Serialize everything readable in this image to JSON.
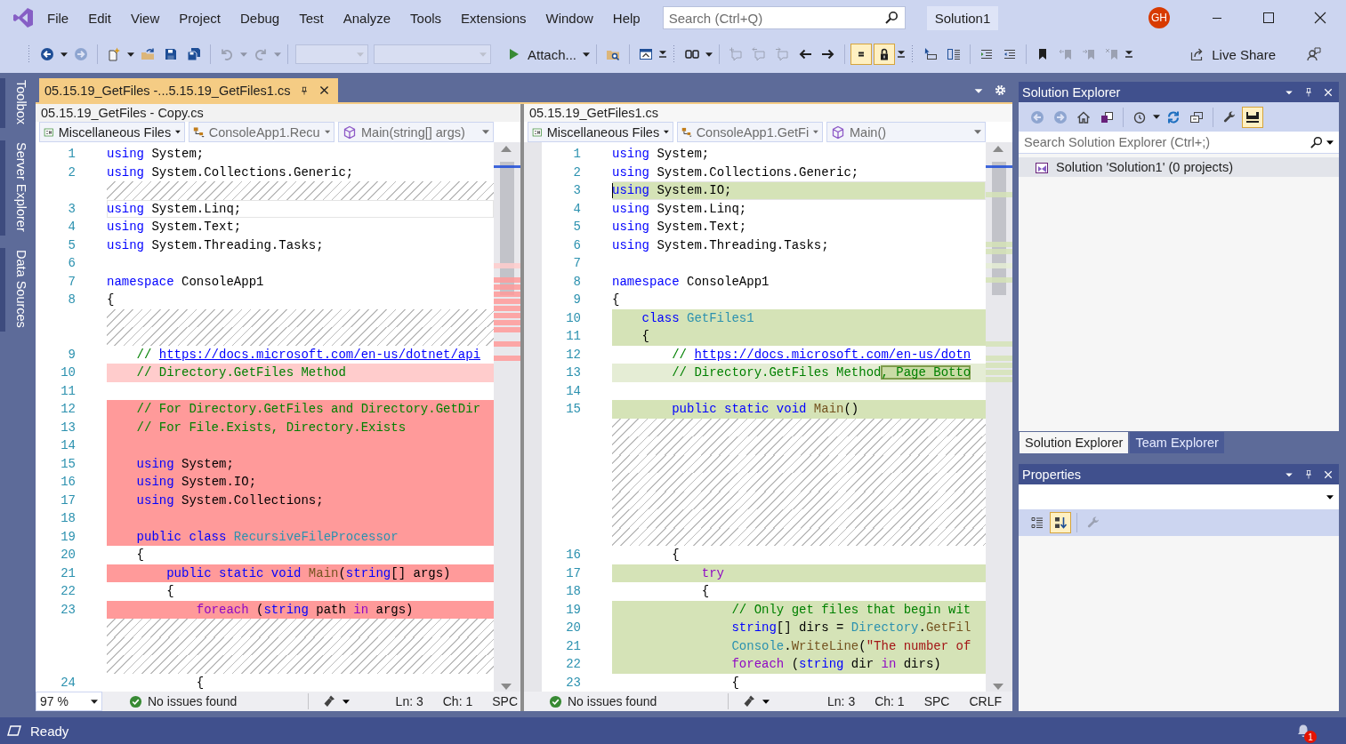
{
  "menu": [
    {
      "label": "File"
    },
    {
      "label": "Edit"
    },
    {
      "label": "View"
    },
    {
      "label": "Project"
    },
    {
      "label": "Debug"
    },
    {
      "label": "Test"
    },
    {
      "label": "Analyze"
    },
    {
      "label": "Tools"
    },
    {
      "label": "Extensions"
    },
    {
      "label": "Window"
    },
    {
      "label": "Help"
    }
  ],
  "search": {
    "placeholder": "Search (Ctrl+Q)"
  },
  "solution_name": "Solution1",
  "account": {
    "initials": "GH"
  },
  "toolbar": [
    {
      "kind": "grip"
    },
    {
      "kind": "back",
      "disabled": false
    },
    {
      "kind": "dropdown",
      "disabled": false
    },
    {
      "kind": "forward",
      "disabled": true
    },
    {
      "kind": "separator"
    },
    {
      "kind": "new-item",
      "disabled": false
    },
    {
      "kind": "dropdown",
      "disabled": false
    },
    {
      "kind": "open",
      "disabled": false
    },
    {
      "kind": "save",
      "disabled": false
    },
    {
      "kind": "save-all",
      "disabled": false
    },
    {
      "kind": "separator"
    },
    {
      "kind": "undo",
      "disabled": true
    },
    {
      "kind": "dropdown",
      "disabled": true
    },
    {
      "kind": "redo",
      "disabled": true
    },
    {
      "kind": "dropdown",
      "disabled": true
    },
    {
      "kind": "separator"
    },
    {
      "kind": "combo",
      "disabled": true
    },
    {
      "kind": "combo",
      "disabled": true
    },
    {
      "kind": "run",
      "label": "Attach...",
      "disabled": false
    },
    {
      "kind": "dropdown",
      "disabled": false
    },
    {
      "kind": "separator"
    },
    {
      "kind": "find-folder",
      "disabled": false
    },
    {
      "kind": "separator"
    },
    {
      "kind": "window",
      "disabled": false
    },
    {
      "kind": "overflow",
      "disabled": false
    },
    {
      "kind": "grip"
    },
    {
      "kind": "layout",
      "disabled": false
    },
    {
      "kind": "dropdown",
      "disabled": false
    },
    {
      "kind": "separator"
    },
    {
      "kind": "comment-add",
      "disabled": true
    },
    {
      "kind": "comment-prev",
      "disabled": true
    },
    {
      "kind": "comment-next",
      "disabled": true
    },
    {
      "kind": "arrow-left",
      "disabled": false
    },
    {
      "kind": "arrow-right",
      "disabled": false
    },
    {
      "kind": "separator"
    },
    {
      "kind": "equal",
      "disabled": false,
      "checked": true
    },
    {
      "kind": "lock",
      "disabled": false,
      "checked": true
    },
    {
      "kind": "overflow",
      "disabled": false
    },
    {
      "kind": "grip"
    },
    {
      "kind": "cursor-field",
      "disabled": false
    },
    {
      "kind": "compare",
      "disabled": false
    },
    {
      "kind": "separator"
    },
    {
      "kind": "indent",
      "disabled": false
    },
    {
      "kind": "outdent",
      "disabled": false
    },
    {
      "kind": "separator"
    },
    {
      "kind": "bookmark",
      "disabled": false
    },
    {
      "kind": "bookmark-prev",
      "disabled": true
    },
    {
      "kind": "bookmark-next",
      "disabled": true
    },
    {
      "kind": "bookmark-clear",
      "disabled": true
    },
    {
      "kind": "overflow",
      "disabled": false
    }
  ],
  "live_share": {
    "label": "Live Share"
  },
  "side_tabs": [
    {
      "label": "Toolbox"
    },
    {
      "label": "Server Explorer"
    },
    {
      "label": "Data Sources"
    }
  ],
  "document_tab": {
    "title": "05.15.19_GetFiles -...5.15.19_GetFiles1.cs",
    "selected": true
  },
  "panes": [
    {
      "kind": "before",
      "focused": false,
      "file": "05.15.19_GetFiles - Copy.cs",
      "nav": [
        {
          "kind": "project",
          "label": "Miscellaneous Files"
        },
        {
          "kind": "class",
          "label": "ConsoleApp1.Recu"
        },
        {
          "kind": "member",
          "label": "Main(string[] args)"
        }
      ],
      "lines": [
        {
          "kind": "code",
          "number": "1",
          "changed": false,
          "current": false,
          "spans": [
            {
              "text": "using",
              "kind": "keyword"
            },
            {
              "text": " System;",
              "kind": "plain"
            }
          ]
        },
        {
          "kind": "code",
          "number": "2",
          "changed": false,
          "current": false,
          "spans": [
            {
              "text": "using",
              "kind": "keyword"
            },
            {
              "text": " System.Collections.Generic;",
              "kind": "plain"
            }
          ]
        },
        {
          "kind": "gap"
        },
        {
          "kind": "code",
          "number": "3",
          "changed": false,
          "current": true,
          "spans": [
            {
              "text": "using",
              "kind": "keyword"
            },
            {
              "text": " System.Linq;",
              "kind": "plain"
            }
          ]
        },
        {
          "kind": "code",
          "number": "4",
          "changed": false,
          "current": false,
          "spans": [
            {
              "text": "using",
              "kind": "keyword"
            },
            {
              "text": " System.Text;",
              "kind": "plain"
            }
          ]
        },
        {
          "kind": "code",
          "number": "5",
          "changed": false,
          "current": false,
          "spans": [
            {
              "text": "using",
              "kind": "keyword"
            },
            {
              "text": " System.Threading.Tasks;",
              "kind": "plain"
            }
          ]
        },
        {
          "kind": "code",
          "number": "6",
          "changed": false,
          "current": false
        },
        {
          "kind": "code",
          "number": "7",
          "changed": false,
          "current": false,
          "spans": [
            {
              "text": "namespace",
              "kind": "keyword"
            },
            {
              "text": " ConsoleApp1",
              "kind": "plain"
            }
          ]
        },
        {
          "kind": "code",
          "number": "8",
          "changed": false,
          "current": false,
          "spans": [
            {
              "text": "{",
              "kind": "plain"
            }
          ]
        },
        {
          "kind": "gap"
        },
        {
          "kind": "gap"
        },
        {
          "kind": "code",
          "number": "9",
          "changed": false,
          "current": false,
          "spans": [
            {
              "text": "    // ",
              "kind": "comment"
            },
            {
              "text": "https://docs.microsoft.com/en-us/dotnet/api",
              "kind": "link"
            }
          ]
        },
        {
          "kind": "edited",
          "number": "10",
          "current": false,
          "spans": [
            {
              "text": "    // Directory.GetFiles Method",
              "kind": "comment"
            }
          ]
        },
        {
          "kind": "code",
          "number": "11",
          "changed": false,
          "current": false
        },
        {
          "kind": "code",
          "number": "12",
          "changed": true,
          "current": false,
          "spans": [
            {
              "text": "    // For Directory.GetFiles and Directory.GetDir",
              "kind": "comment"
            }
          ]
        },
        {
          "kind": "code",
          "number": "13",
          "changed": true,
          "current": false,
          "spans": [
            {
              "text": "    // For File.Exists, Directory.Exists",
              "kind": "comment"
            }
          ]
        },
        {
          "kind": "code",
          "number": "14",
          "changed": true,
          "current": false
        },
        {
          "kind": "code",
          "number": "15",
          "changed": true,
          "current": false,
          "spans": [
            {
              "text": "    using",
              "kind": "keyword"
            },
            {
              "text": " System;",
              "kind": "plain"
            }
          ]
        },
        {
          "kind": "code",
          "number": "16",
          "changed": true,
          "current": false,
          "spans": [
            {
              "text": "    using",
              "kind": "keyword"
            },
            {
              "text": " System.IO;",
              "kind": "plain"
            }
          ]
        },
        {
          "kind": "code",
          "number": "17",
          "changed": true,
          "current": false,
          "spans": [
            {
              "text": "    using",
              "kind": "keyword"
            },
            {
              "text": " System.Collections;",
              "kind": "plain"
            }
          ]
        },
        {
          "kind": "code",
          "number": "18",
          "changed": true,
          "current": false
        },
        {
          "kind": "code",
          "number": "19",
          "changed": true,
          "current": false,
          "spans": [
            {
              "text": "    public class ",
              "kind": "keyword"
            },
            {
              "text": "RecursiveFileProcessor",
              "kind": "type"
            }
          ]
        },
        {
          "kind": "code",
          "number": "20",
          "changed": false,
          "current": false,
          "spans": [
            {
              "text": "    {",
              "kind": "plain"
            }
          ]
        },
        {
          "kind": "code",
          "number": "21",
          "changed": true,
          "current": false,
          "spans": [
            {
              "text": "        public static void ",
              "kind": "keyword"
            },
            {
              "text": "Main",
              "kind": "method"
            },
            {
              "text": "(",
              "kind": "plain"
            },
            {
              "text": "string",
              "kind": "keyword"
            },
            {
              "text": "[] args)",
              "kind": "plain"
            }
          ]
        },
        {
          "kind": "code",
          "number": "22",
          "changed": false,
          "current": false,
          "spans": [
            {
              "text": "        {",
              "kind": "plain"
            }
          ]
        },
        {
          "kind": "code",
          "number": "23",
          "changed": true,
          "current": false,
          "spans": [
            {
              "text": "            foreach",
              "kind": "control"
            },
            {
              "text": " (",
              "kind": "plain"
            },
            {
              "text": "string",
              "kind": "keyword"
            },
            {
              "text": " path ",
              "kind": "plain"
            },
            {
              "text": "in",
              "kind": "control"
            },
            {
              "text": " args)",
              "kind": "plain"
            }
          ]
        },
        {
          "kind": "gap"
        },
        {
          "kind": "gap"
        },
        {
          "kind": "gap"
        },
        {
          "kind": "code",
          "number": "24",
          "changed": false,
          "current": false,
          "spans": [
            {
              "text": "            {",
              "kind": "plain"
            }
          ]
        }
      ],
      "status": {
        "zoom": "97 %",
        "issues": "No issues found",
        "ln": "Ln: 3",
        "ch": "Ch: 1",
        "spc": "SPC"
      }
    },
    {
      "kind": "after",
      "focused": true,
      "file": "05.15.19_GetFiles1.cs",
      "nav": [
        {
          "kind": "project",
          "label": "Miscellaneous Files"
        },
        {
          "kind": "class",
          "label": "ConsoleApp1.GetFi"
        },
        {
          "kind": "member",
          "label": "Main()"
        }
      ],
      "lines": [
        {
          "kind": "code",
          "number": "1",
          "changed": false,
          "current": false,
          "spans": [
            {
              "text": "using",
              "kind": "keyword"
            },
            {
              "text": " System;",
              "kind": "plain"
            }
          ]
        },
        {
          "kind": "code",
          "number": "2",
          "changed": false,
          "current": false,
          "spans": [
            {
              "text": "using",
              "kind": "keyword"
            },
            {
              "text": " System.Collections.Generic;",
              "kind": "plain"
            }
          ]
        },
        {
          "kind": "code",
          "number": "3",
          "changed": true,
          "current": true,
          "spans": [
            {
              "text": "using",
              "kind": "keyword"
            },
            {
              "text": " System.IO;",
              "kind": "plain"
            }
          ]
        },
        {
          "kind": "code",
          "number": "4",
          "changed": false,
          "current": false,
          "spans": [
            {
              "text": "using",
              "kind": "keyword"
            },
            {
              "text": " System.Linq;",
              "kind": "plain"
            }
          ]
        },
        {
          "kind": "code",
          "number": "5",
          "changed": false,
          "current": false,
          "spans": [
            {
              "text": "using",
              "kind": "keyword"
            },
            {
              "text": " System.Text;",
              "kind": "plain"
            }
          ]
        },
        {
          "kind": "code",
          "number": "6",
          "changed": false,
          "current": false,
          "spans": [
            {
              "text": "using",
              "kind": "keyword"
            },
            {
              "text": " System.Threading.Tasks;",
              "kind": "plain"
            }
          ]
        },
        {
          "kind": "code",
          "number": "7",
          "changed": false,
          "current": false
        },
        {
          "kind": "code",
          "number": "8",
          "changed": false,
          "current": false,
          "spans": [
            {
              "text": "namespace",
              "kind": "keyword"
            },
            {
              "text": " ConsoleApp1",
              "kind": "plain"
            }
          ]
        },
        {
          "kind": "code",
          "number": "9",
          "changed": false,
          "current": false,
          "spans": [
            {
              "text": "{",
              "kind": "plain"
            }
          ]
        },
        {
          "kind": "code",
          "number": "10",
          "changed": true,
          "current": false,
          "spans": [
            {
              "text": "    class ",
              "kind": "keyword"
            },
            {
              "text": "GetFiles1",
              "kind": "type"
            }
          ]
        },
        {
          "kind": "code",
          "number": "11",
          "changed": true,
          "current": false,
          "spans": [
            {
              "text": "    {",
              "kind": "plain"
            }
          ]
        },
        {
          "kind": "code",
          "number": "12",
          "changed": false,
          "current": false,
          "spans": [
            {
              "text": "        // ",
              "kind": "comment"
            },
            {
              "text": "https://docs.microsoft.com/en-us/dotn",
              "kind": "link"
            }
          ]
        },
        {
          "kind": "edited",
          "number": "13",
          "current": false,
          "spans": [
            {
              "text": "        // Directory.GetFiles Method",
              "kind": "comment"
            },
            {
              "text": ", Page Botto",
              "kind": "changed"
            }
          ]
        },
        {
          "kind": "code",
          "number": "14",
          "changed": false,
          "current": false
        },
        {
          "kind": "code",
          "number": "15",
          "changed": true,
          "current": false,
          "spans": [
            {
              "text": "        public static void ",
              "kind": "keyword"
            },
            {
              "text": "Main",
              "kind": "method"
            },
            {
              "text": "()",
              "kind": "plain"
            }
          ]
        },
        {
          "kind": "gap"
        },
        {
          "kind": "gap"
        },
        {
          "kind": "gap"
        },
        {
          "kind": "gap"
        },
        {
          "kind": "gap"
        },
        {
          "kind": "gap"
        },
        {
          "kind": "gap"
        },
        {
          "kind": "code",
          "number": "16",
          "changed": false,
          "current": false,
          "spans": [
            {
              "text": "        {",
              "kind": "plain"
            }
          ]
        },
        {
          "kind": "code",
          "number": "17",
          "changed": true,
          "current": false,
          "spans": [
            {
              "text": "            try",
              "kind": "control"
            }
          ]
        },
        {
          "kind": "code",
          "number": "18",
          "changed": false,
          "current": false,
          "spans": [
            {
              "text": "            {",
              "kind": "plain"
            }
          ]
        },
        {
          "kind": "code",
          "number": "19",
          "changed": true,
          "current": false,
          "spans": [
            {
              "text": "                // Only get files that begin wit",
              "kind": "comment"
            }
          ]
        },
        {
          "kind": "code",
          "number": "20",
          "changed": true,
          "current": false,
          "spans": [
            {
              "text": "                string",
              "kind": "keyword"
            },
            {
              "text": "[] dirs = ",
              "kind": "plain"
            },
            {
              "text": "Directory",
              "kind": "type"
            },
            {
              "text": ".",
              "kind": "plain"
            },
            {
              "text": "GetFil",
              "kind": "method"
            }
          ]
        },
        {
          "kind": "code",
          "number": "21",
          "changed": true,
          "current": false,
          "spans": [
            {
              "text": "                Console",
              "kind": "type"
            },
            {
              "text": ".",
              "kind": "plain"
            },
            {
              "text": "WriteLine",
              "kind": "method"
            },
            {
              "text": "(",
              "kind": "plain"
            },
            {
              "text": "\"The number of",
              "kind": "string"
            }
          ]
        },
        {
          "kind": "code",
          "number": "22",
          "changed": true,
          "current": false,
          "spans": [
            {
              "text": "                foreach",
              "kind": "control"
            },
            {
              "text": " (",
              "kind": "plain"
            },
            {
              "text": "string",
              "kind": "keyword"
            },
            {
              "text": " dir ",
              "kind": "plain"
            },
            {
              "text": "in",
              "kind": "control"
            },
            {
              "text": " dirs)",
              "kind": "plain"
            }
          ]
        },
        {
          "kind": "code",
          "number": "23",
          "changed": false,
          "current": false,
          "spans": [
            {
              "text": "                {",
              "kind": "plain"
            }
          ]
        }
      ],
      "status": {
        "issues": "No issues found",
        "ln": "Ln: 3",
        "ch": "Ch: 1",
        "spc": "SPC",
        "eol": "CRLF"
      }
    }
  ],
  "solution_explorer": {
    "title": "Solution Explorer",
    "toolbar": [
      {
        "kind": "back",
        "disabled": true
      },
      {
        "kind": "forward",
        "disabled": true
      },
      {
        "kind": "home",
        "disabled": false
      },
      {
        "kind": "views",
        "disabled": false
      },
      {
        "kind": "separator"
      },
      {
        "kind": "history",
        "disabled": false
      },
      {
        "kind": "dropdown",
        "disabled": false
      },
      {
        "kind": "sync",
        "disabled": false
      },
      {
        "kind": "collapse",
        "disabled": false
      },
      {
        "kind": "separator"
      },
      {
        "kind": "wrench",
        "disabled": false
      },
      {
        "kind": "preview",
        "disabled": false,
        "checked": true
      }
    ],
    "search": {
      "placeholder": "Search Solution Explorer (Ctrl+;)"
    },
    "tree": [
      {
        "label": "Solution 'Solution1' (0 projects)",
        "selected": true
      }
    ],
    "tabs": [
      {
        "label": "Solution Explorer",
        "selected": true
      },
      {
        "label": "Team Explorer",
        "selected": false
      }
    ]
  },
  "properties": {
    "title": "Properties",
    "toolbar": [
      {
        "kind": "categorized",
        "disabled": false
      },
      {
        "kind": "alphabetical",
        "disabled": false,
        "checked": true
      },
      {
        "kind": "separator"
      },
      {
        "kind": "wrench",
        "disabled": true
      }
    ]
  },
  "status_bar": {
    "text": "Ready",
    "notifications": "1"
  }
}
